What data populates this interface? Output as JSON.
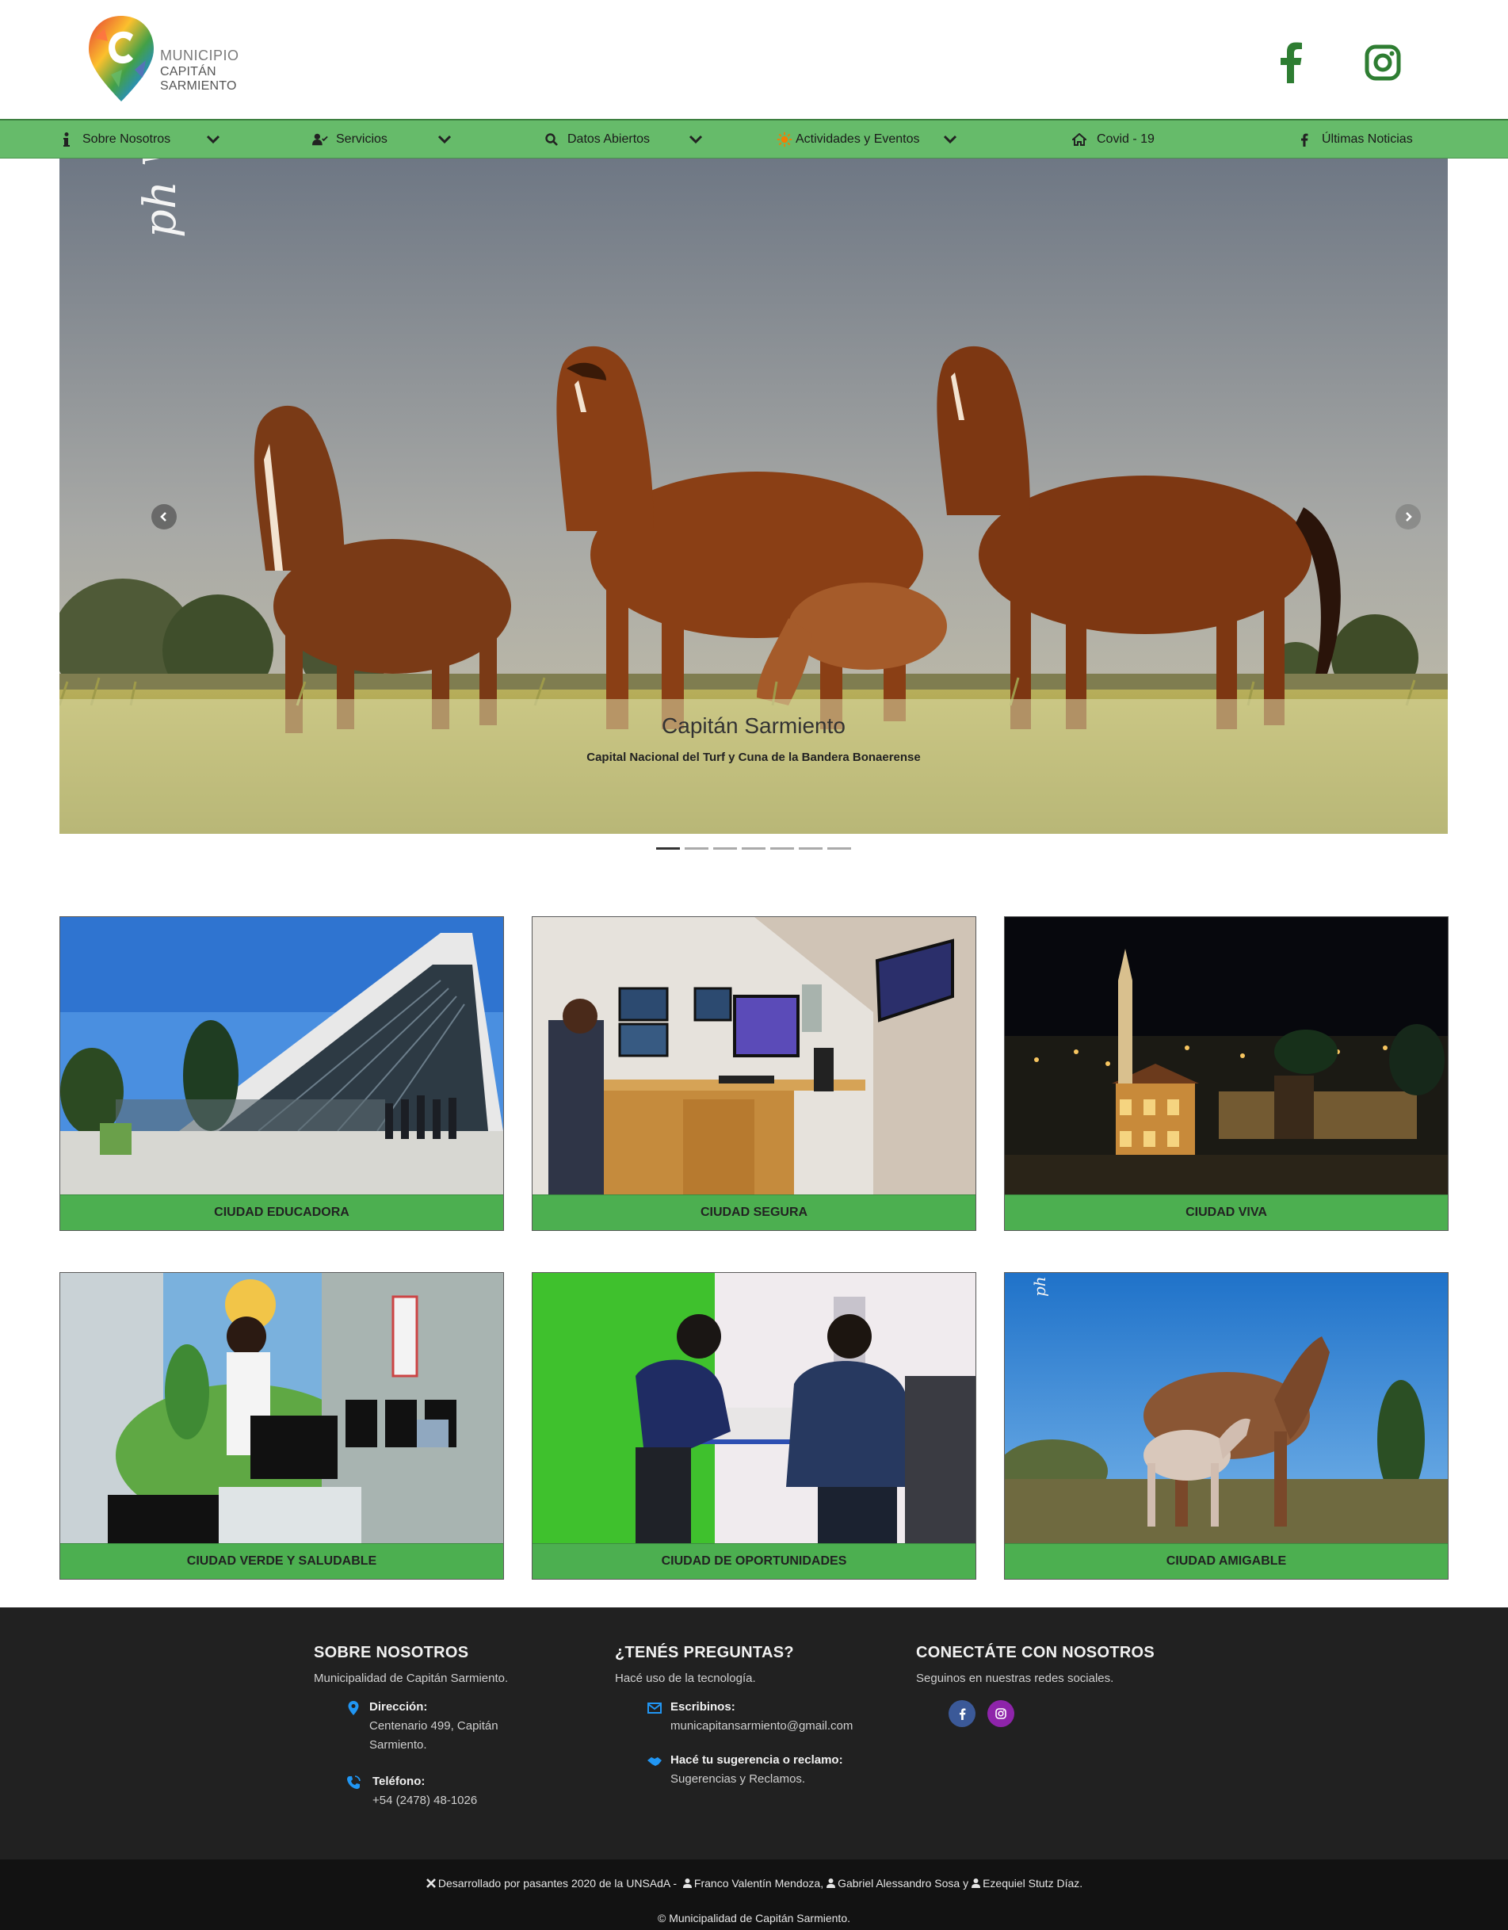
{
  "header": {
    "logo_line1": "MUNICIPIO",
    "logo_line2": "CAPITÁN SARMIENTO",
    "social": [
      {
        "name": "facebook",
        "icon": "facebook-icon",
        "color": "#2e7d32"
      },
      {
        "name": "instagram",
        "icon": "instagram-icon",
        "color": "#2e7d32"
      }
    ]
  },
  "nav": {
    "background": "#66bb6a",
    "items": [
      {
        "label": "Sobre Nosotros",
        "icon": "info-icon",
        "dropdown": true
      },
      {
        "label": "Servicios",
        "icon": "user-check-icon",
        "dropdown": true
      },
      {
        "label": "Datos Abiertos",
        "icon": "search-icon",
        "dropdown": true
      },
      {
        "label": "Actividades y Eventos",
        "icon": "sun-icon",
        "dropdown": true
      },
      {
        "label": "Covid - 19",
        "icon": "home-icon",
        "dropdown": false
      },
      {
        "label": "Últimas Noticias",
        "icon": "facebook-icon",
        "dropdown": false
      }
    ]
  },
  "carousel": {
    "title": "Capitán Sarmiento",
    "subtitle": "Capital Nacional del Turf y Cuna de la Bandera Bonaerense",
    "watermark": "ph Vare",
    "slide_count": 7,
    "active_slide": 1
  },
  "cards": [
    {
      "label": "CIUDAD EDUCADORA"
    },
    {
      "label": "CIUDAD SEGURA"
    },
    {
      "label": "CIUDAD VIVA"
    },
    {
      "label": "CIUDAD VERDE Y SALUDABLE"
    },
    {
      "label": "CIUDAD DE OPORTUNIDADES"
    },
    {
      "label": "CIUDAD AMIGABLE"
    }
  ],
  "footer": {
    "about": {
      "title": "SOBRE NOSOTROS",
      "desc": "Municipalidad de Capitán Sarmiento.",
      "address_label": "Dirección:",
      "address_value": "Centenario 499, Capitán Sarmiento.",
      "phone_label": "Teléfono:",
      "phone_value": "+54 (2478) 48-1026"
    },
    "questions": {
      "title": "¿TENÉS PREGUNTAS?",
      "desc": "Hacé uso de la tecnología.",
      "email_label": "Escribinos:",
      "email_value": "municapitansarmiento@gmail.com",
      "claim_label": "Hacé tu sugerencia o reclamo:",
      "claim_value": "Sugerencias y Reclamos."
    },
    "connect": {
      "title": "CONECTÁTE CON NOSOTROS",
      "desc": "Seguinos en nuestras redes sociales.",
      "facebook_color": "#3b5998",
      "instagram_color": "#8e24aa"
    }
  },
  "bottom": {
    "dev_text": "Desarrollado por pasantes 2020 de la UNSAdA - ",
    "dev1": "Franco Valentín Mendoza,",
    "dev2": "Gabriel Alessandro Sosa y",
    "dev3": "Ezequiel Stutz Díaz.",
    "copyright": "© Municipalidad de Capitán Sarmiento."
  }
}
